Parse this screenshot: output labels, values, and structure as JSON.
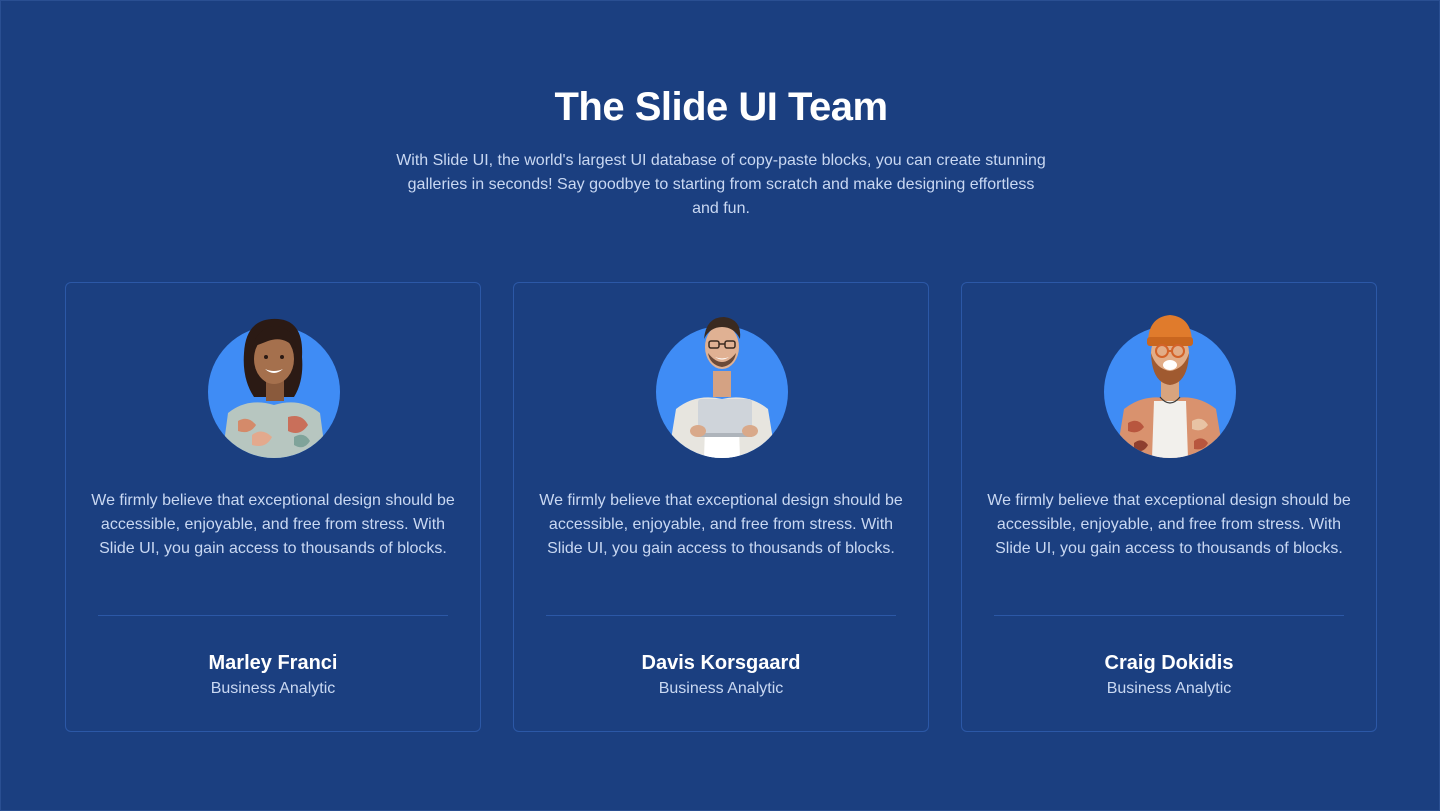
{
  "header": {
    "title": "The Slide UI Team",
    "subtitle": "With Slide UI, the world's largest UI database of copy-paste blocks, you can create stunning galleries in seconds! Say goodbye to starting from scratch and make designing effortless and fun."
  },
  "team": [
    {
      "name": "Marley Franci",
      "role": "Business Analytic",
      "quote": "We firmly believe that exceptional design should be accessible, enjoyable, and free from stress. With Slide UI, you gain access to thousands of blocks."
    },
    {
      "name": "Davis Korsgaard",
      "role": "Business Analytic",
      "quote": "We firmly believe that exceptional design should be accessible, enjoyable, and free from stress. With Slide UI, you gain access to thousands of blocks."
    },
    {
      "name": "Craig Dokidis",
      "role": "Business Analytic",
      "quote": "We firmly believe that exceptional design should be accessible, enjoyable, and free from stress. With Slide UI, you gain access to thousands of blocks."
    }
  ],
  "colors": {
    "background": "#1b3f80",
    "card_border": "#2c58a6",
    "avatar_circle": "#3f8cf5",
    "muted_text": "#c9d8f2"
  }
}
